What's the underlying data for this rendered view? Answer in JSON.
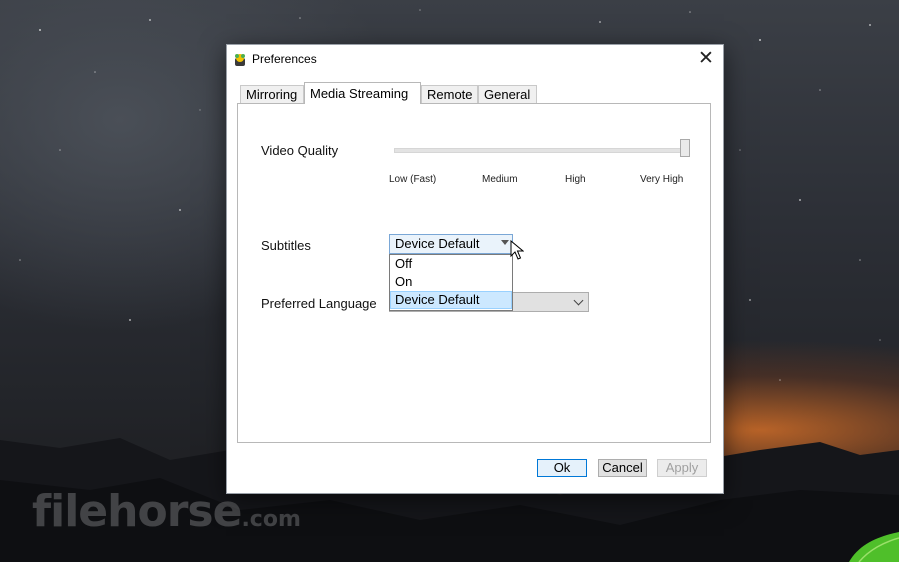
{
  "dialog": {
    "title": "Preferences",
    "close_glyph": "✕",
    "tabs": [
      {
        "label": "Mirroring",
        "active": false
      },
      {
        "label": "Media Streaming",
        "active": true
      },
      {
        "label": "Remote",
        "active": false
      },
      {
        "label": "General",
        "active": false
      }
    ],
    "video_quality": {
      "label": "Video Quality",
      "ticks": [
        "Low (Fast)",
        "Medium",
        "High",
        "Very High"
      ],
      "selected_index": 3,
      "level": 1.0
    },
    "subtitles": {
      "label": "Subtitles",
      "value": "Device Default",
      "options": [
        "Off",
        "On",
        "Device Default"
      ],
      "highlighted": "Device Default"
    },
    "preferred_language": {
      "label": "Preferred Language",
      "value": ""
    },
    "buttons": {
      "ok": "Ok",
      "cancel": "Cancel",
      "apply": "Apply"
    }
  },
  "watermark": {
    "brand": "filehorse",
    "suffix": ".com"
  },
  "colors": {
    "focus_border": "#0078d7",
    "selection_bg": "#cce8ff"
  },
  "icons": {
    "app": "app-logo-icon",
    "close": "close-icon",
    "dropdown": "chevron-down-icon",
    "cursor": "mouse-pointer-icon"
  }
}
